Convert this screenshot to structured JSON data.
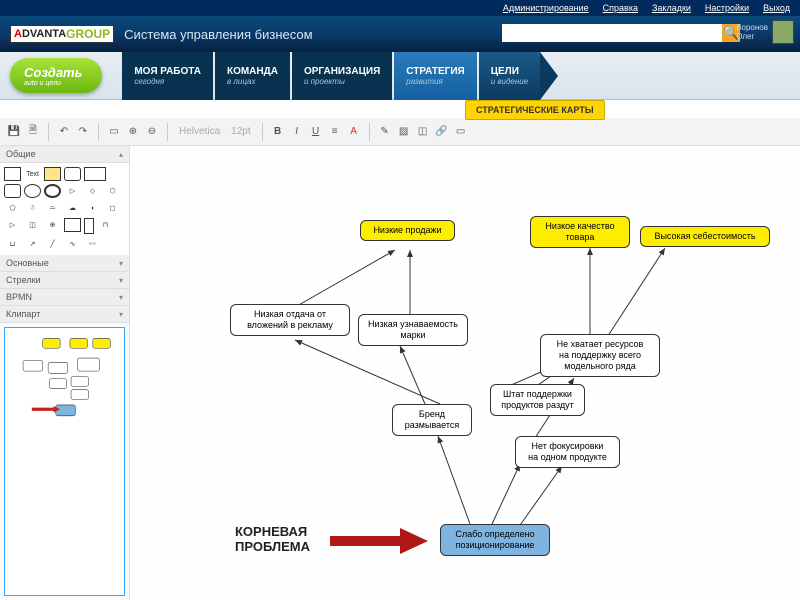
{
  "topbar": {
    "links": [
      "Администрирование",
      "Справка",
      "Закладки",
      "Настройки",
      "Выход"
    ]
  },
  "header": {
    "logo_prefix": "A",
    "logo_mid": "DVANTA",
    "logo_suffix": "GROUP",
    "tagline": "Система управления бизнесом",
    "search_placeholder": "",
    "user_name": "Воронов\nОлег"
  },
  "nav": {
    "create": {
      "label": "Создать",
      "sub": "auto и цели"
    },
    "items": [
      {
        "label": "МОЯ РАБОТА",
        "sub": "сегодня"
      },
      {
        "label": "КОМАНДА",
        "sub": "в лицах"
      },
      {
        "label": "ОРГАНИЗАЦИЯ",
        "sub": "и проекты"
      },
      {
        "label": "СТРАТЕГИЯ",
        "sub": "развития"
      },
      {
        "label": "ЦЕЛИ",
        "sub": "и видение"
      }
    ]
  },
  "subnav": "СТРАТЕГИЧЕСКИЕ КАРТЫ",
  "toolbar": {
    "font": "Helvetica",
    "size": "12pt"
  },
  "palette": {
    "cats": [
      "Общие",
      "Основные",
      "Стрелки",
      "BPMN",
      "Клипарт"
    ],
    "text_shape": "Text"
  },
  "nodes": {
    "n1": "Низкие продажи",
    "n2": "Низкое качество\nтовара",
    "n3": "Высокая себестоимость",
    "n4": "Низкая отдача от\nвложений в рекламу",
    "n5": "Низкая узнаваемость\nмарки",
    "n6": "Не хватает ресурсов\nна поддержку всего\nмодельного ряда",
    "n7": "Бренд\nразмывается",
    "n8": "Штат поддержки\nпродуктов раздут",
    "n9": "Нет фокусировки\nна одном продукте",
    "root": "Слабо определено\nпозиционирование"
  },
  "root_label": "КОРНЕВАЯ\nПРОБЛЕМА"
}
